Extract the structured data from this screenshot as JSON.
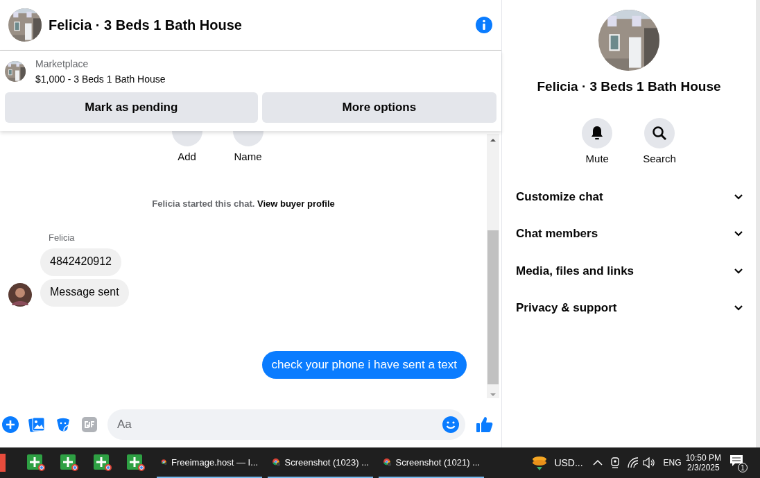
{
  "header": {
    "title": "Felicia · 3 Beds 1 Bath House"
  },
  "listing": {
    "source": "Marketplace",
    "title": "$1,000 - 3 Beds 1 Bath House",
    "buttons": [
      "Mark as pending",
      "More options"
    ]
  },
  "quick_actions": [
    "Add",
    "Name"
  ],
  "chat_notice": {
    "text": "Felicia started this chat.",
    "link": "View buyer profile"
  },
  "messages": [
    {
      "kind": "incoming",
      "sender": "Felicia",
      "text": "4842420912",
      "avatar": false
    },
    {
      "kind": "incoming",
      "text": "Message sent",
      "avatar": true
    },
    {
      "kind": "outgoing",
      "text": "check your phone i have sent a text"
    }
  ],
  "composer": {
    "placeholder": "Aa"
  },
  "info_panel": {
    "title": "Felicia · 3 Beds 1 Bath House",
    "actions": [
      {
        "kind": "mute",
        "label": "Mute"
      },
      {
        "kind": "search",
        "label": "Search"
      }
    ],
    "sections": [
      {
        "label": "Customize chat",
        "expanded": false
      },
      {
        "label": "Chat members",
        "expanded": false
      },
      {
        "label": "Media, files and links",
        "expanded": false
      },
      {
        "label": "Privacy & support",
        "expanded": false
      }
    ]
  },
  "taskbar": {
    "pinned": [
      {
        "kind": "red"
      },
      {
        "kind": "sheet"
      },
      {
        "kind": "sheet"
      },
      {
        "kind": "sheet"
      },
      {
        "kind": "sheet"
      }
    ],
    "windows": [
      {
        "label": "Freeimage.host — I..."
      },
      {
        "label": "Screenshot (1023) ..."
      },
      {
        "label": "Screenshot (1021) ..."
      }
    ],
    "tray_app": "USD...",
    "language": "ENG",
    "time": "10:50 PM",
    "date": "2/3/2025",
    "notifications": "1"
  }
}
